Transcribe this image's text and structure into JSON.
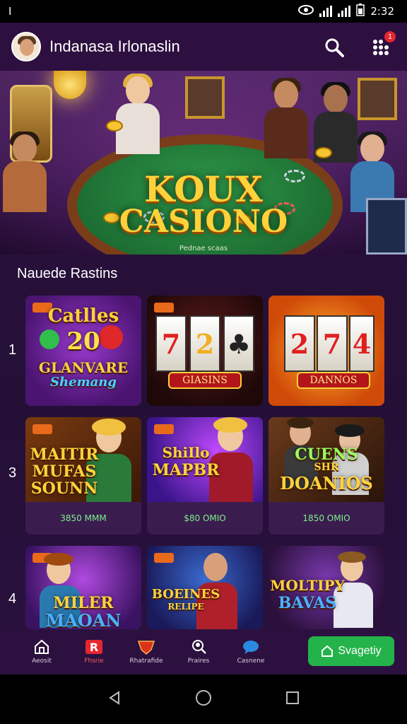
{
  "status_bar": {
    "left_indicator": "I",
    "time": "2:32"
  },
  "header": {
    "title": "Indanasa Irlonaslin",
    "notification_count": "1"
  },
  "hero": {
    "logo_line1": "KOUX",
    "logo_line2": "CASIONO",
    "subtitle": "Pednae scaas"
  },
  "section": {
    "title": "Nauede Rastins"
  },
  "rows": [
    {
      "number": "1"
    },
    {
      "number": "3"
    },
    {
      "number": "4"
    }
  ],
  "cards": [
    {
      "lines": [
        "Catlles",
        "20",
        "GLANVARE",
        "Shemang"
      ]
    },
    {
      "reels": [
        "7",
        "2",
        "♣"
      ],
      "banner": "GIASINS"
    },
    {
      "reels": [
        "2",
        "7",
        "4"
      ],
      "banner": "DANNOS"
    },
    {
      "lines": [
        "MAITIR",
        "MUFAS",
        "SOUNN"
      ],
      "caption": "3850 MMM"
    },
    {
      "lines": [
        "ShiIlo",
        "MAPBR"
      ],
      "caption": "$80 OMIO"
    },
    {
      "lines": [
        "CUENS",
        "SHR",
        "DOANIOS"
      ],
      "caption": "1850 OMIO"
    },
    {
      "lines": [
        "MILER",
        "MAOAN"
      ]
    },
    {
      "lines": [
        "BOEINES",
        "RELIPE"
      ]
    },
    {
      "lines": [
        "MOLTIPY",
        "BAVAS"
      ]
    }
  ],
  "bottom_nav": {
    "items": [
      {
        "label": "Aeosit",
        "icon": "home-icon"
      },
      {
        "label": "Fhsrie",
        "icon": "r-logo-icon"
      },
      {
        "label": "Rhatrafide",
        "icon": "shield-icon"
      },
      {
        "label": "Praires",
        "icon": "search-person-icon"
      },
      {
        "label": "Casnene",
        "icon": "chat-icon"
      }
    ],
    "cta_label": "Svagetiy"
  },
  "colors": {
    "accent_green": "#24b34a",
    "background": "#2b0f3e",
    "gold": "#ffd23a"
  }
}
